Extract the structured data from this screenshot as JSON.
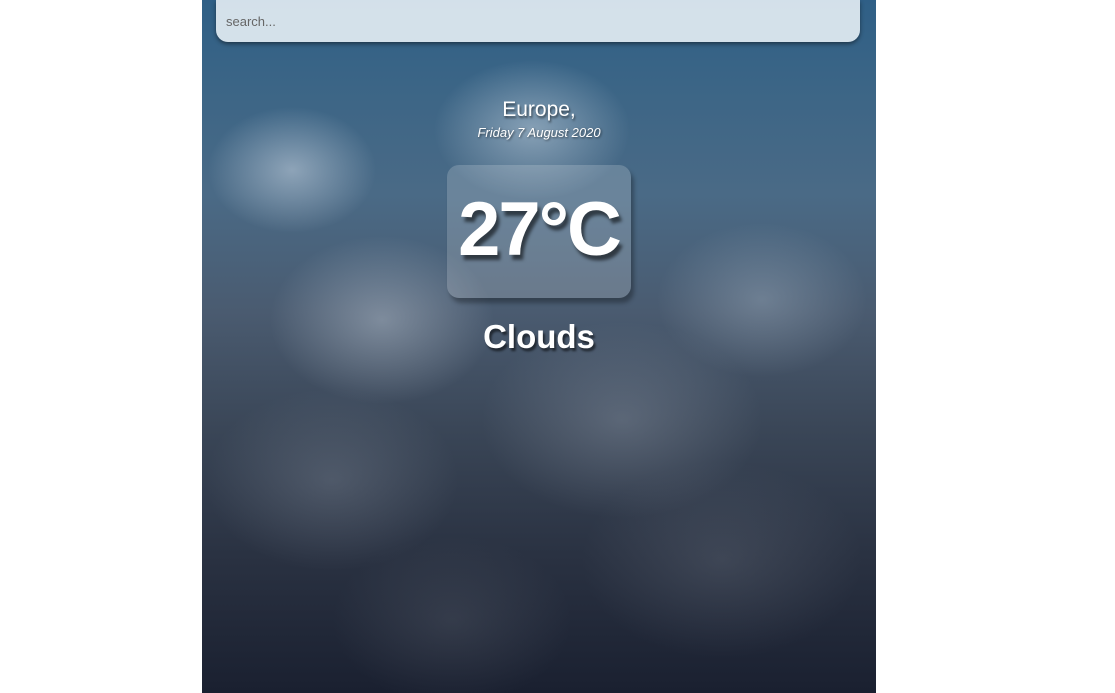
{
  "search": {
    "placeholder": "search...",
    "value": ""
  },
  "location": {
    "name": "Europe,",
    "date": "Friday 7 August 2020"
  },
  "weather": {
    "temperature": "27°C",
    "condition": "Clouds"
  }
}
